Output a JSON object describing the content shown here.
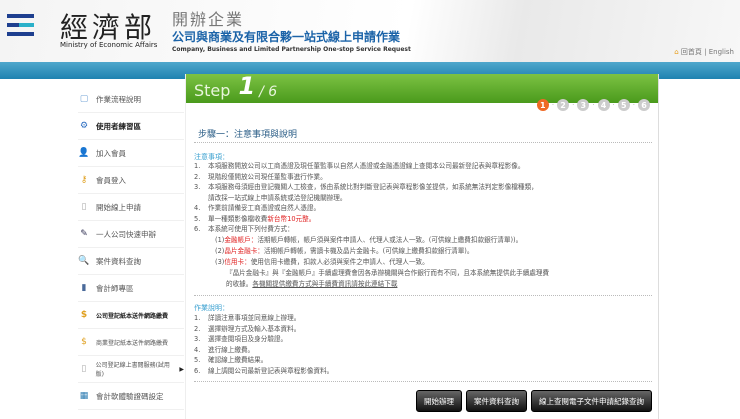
{
  "header": {
    "ministry_zh": "經濟部",
    "ministry_en": "Ministry of Economic Affairs",
    "site_top": "開辦企業",
    "site_title": "公司與商業及有限合夥一站式線上申請作業",
    "site_en": "Company, Business and Limited Partnership One-stop Service Request",
    "home": "回首頁",
    "sep": "|",
    "english": "English"
  },
  "sidebar": {
    "items": [
      {
        "label": "作業流程說明",
        "icon": "chat-icon"
      },
      {
        "label": "使用者練習區",
        "icon": "gears-icon"
      },
      {
        "label": "加入會員",
        "icon": "user-icon"
      },
      {
        "label": "會員登入",
        "icon": "key-icon"
      },
      {
        "label": "開始線上申請",
        "icon": "document-icon"
      },
      {
        "label": "一人公司快速申辦",
        "icon": "edit-icon"
      },
      {
        "label": "案件資料查詢",
        "icon": "search-icon"
      },
      {
        "label": "會計師專區",
        "icon": "book-icon"
      },
      {
        "label": "公司登記紙本送件網路繳費",
        "icon": "payment-icon"
      },
      {
        "label": "商業登記紙本送件網路繳費",
        "icon": "payment-icon"
      },
      {
        "label": "公司登記線上書閱服務(試用版)",
        "icon": "phone-icon"
      },
      {
        "label": "會計軟體驗證碼設定",
        "icon": "calculator-icon"
      }
    ]
  },
  "step": {
    "word": "Step",
    "current": "1",
    "total": "/ 6",
    "dots": [
      "1",
      "2",
      "3",
      "4",
      "5",
      "6"
    ]
  },
  "main": {
    "title": "步驟一：注意事項與說明",
    "notice_heading": "注意事項：",
    "notices": [
      {
        "n": "1.",
        "t": "本項服務開放公司以工商憑證及現任董監事以自然人憑證或金融憑證線上查閱本公司最新登記表與章程影像。"
      },
      {
        "n": "2.",
        "t": "現階段僅開放公司現任董監事進行作業。"
      },
      {
        "n": "3.",
        "t": "本項服務母須經由登記機關人工檢查，係由系統比對判斷登記表與章程影像並提供，如系統無法判定影像檔種類，"
      },
      {
        "n": "",
        "t": "請改採一站式線上申請系統或洽登記機關辦理。"
      },
      {
        "n": "4.",
        "t": "作業前請備妥工商憑證或自然人憑證。"
      },
      {
        "n": "5.",
        "t": "單一種類影像檔收費",
        "red": "新台幣10元整。"
      },
      {
        "n": "6.",
        "t": "本系統可使用下列付費方式："
      }
    ],
    "payments": [
      {
        "pre": "(1)",
        "red": "金融帳戶：",
        "t": "活期帳戶轉帳，帳戶須與案件申請人、代理人或法人一致。(可供線上繳費扣款銀行清單))。"
      },
      {
        "pre": "(2)",
        "red": "晶片金融卡：",
        "t": "活期帳戶轉帳，需讀卡機及晶片金融卡。(可供線上繳費扣款銀行清單)。"
      },
      {
        "pre": "(3)",
        "red": "信用卡：",
        "t": "使用信用卡繳費，扣款人必須與案件之申請人、代理人一致。"
      }
    ],
    "fee_note1": "『晶片金融卡』與『金融帳戶』手續處理費會因各承辦機關與合作銀行而有不同，且本系統無提供此手續處理費",
    "fee_note2_pre": "的收據。",
    "fee_note2_link": "各機關提供繳費方式與手續費資訊請按此連結下載",
    "ops_heading": "作業說明：",
    "ops": [
      {
        "n": "1.",
        "t": "詳讀注意事項並同意線上辦理。"
      },
      {
        "n": "2.",
        "t": "選擇辦理方式及輸入基本資料。"
      },
      {
        "n": "3.",
        "t": "選擇查閱項目及身分驗證。"
      },
      {
        "n": "4.",
        "t": "進行線上繳費。"
      },
      {
        "n": "5.",
        "t": "確認線上繳費結果。"
      },
      {
        "n": "6.",
        "t": "線上調閱公司最新登記表與章程影像資料。"
      }
    ]
  },
  "buttons": {
    "start": "開始辦理",
    "query": "案件資料查詢",
    "record": "線上查閱電子文件申請紀錄查詢"
  }
}
